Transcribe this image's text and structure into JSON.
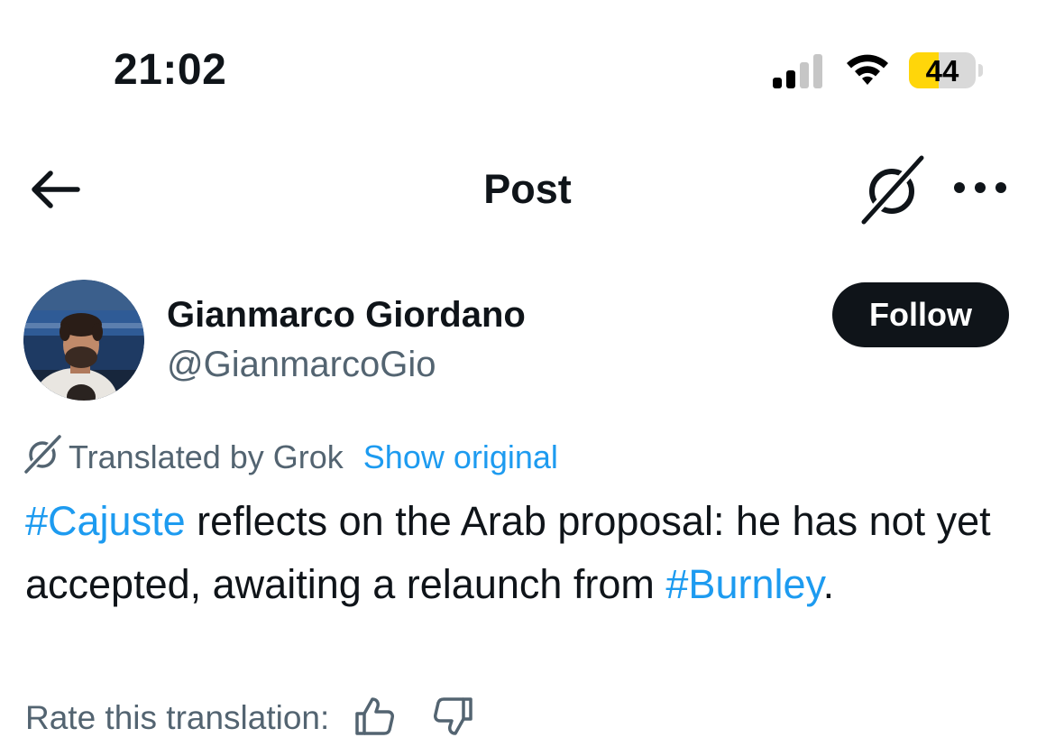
{
  "status_bar": {
    "time": "21:02",
    "battery_percent": "44",
    "battery_level": 0.44,
    "battery_color": "#ffd60a"
  },
  "nav": {
    "title": "Post",
    "back_icon": "arrow-left-icon",
    "grok_icon": "grok-icon",
    "more_icon": "more-horizontal-icon"
  },
  "author": {
    "name": "Gianmarco Giordano",
    "handle": "@GianmarcoGio",
    "follow_label": "Follow"
  },
  "translation": {
    "translated_by": "Translated by Grok",
    "show_original": "Show original"
  },
  "post": {
    "hashtag_1": "#Cajuste",
    "text_1": " reflects on the Arab proposal: he has not yet accepted, awaiting a relaunch from ",
    "hashtag_2": "#Burnley",
    "text_2": "."
  },
  "rating": {
    "label": "Rate this translation:",
    "up_icon": "thumbs-up-icon",
    "down_icon": "thumbs-down-icon"
  },
  "colors": {
    "link": "#1d9bf0",
    "text": "#0f1419",
    "secondary": "#536471",
    "follow_bg": "#0f1419"
  }
}
